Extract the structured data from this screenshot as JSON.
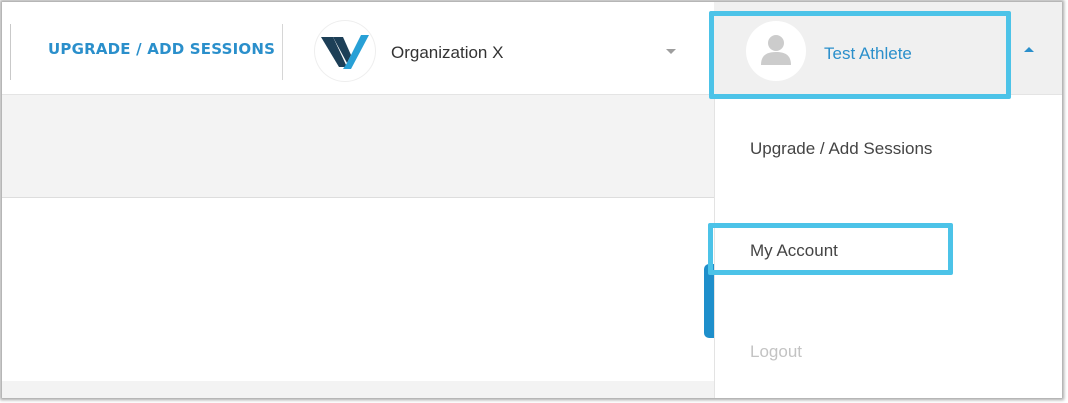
{
  "header": {
    "upgrade_label": "UPGRADE / ADD SESSIONS",
    "organization": {
      "name": "Organization X",
      "logo_icon": "v-chevron-logo-icon"
    },
    "user": {
      "name": "Test Athlete",
      "avatar_icon": "user-silhouette-icon",
      "menu_open": true
    }
  },
  "user_menu": {
    "items": [
      {
        "label": "Upgrade / Add Sessions",
        "enabled": true
      },
      {
        "label": "My Account",
        "enabled": true,
        "highlighted": true
      },
      {
        "label": "Logout",
        "enabled": false
      }
    ]
  },
  "colors": {
    "accent": "#2a8fcb",
    "highlight_outline": "#4cc3e8",
    "logo_dark": "#1d3f57",
    "logo_light": "#28a0d6",
    "disabled_text": "#c3c3c3"
  }
}
